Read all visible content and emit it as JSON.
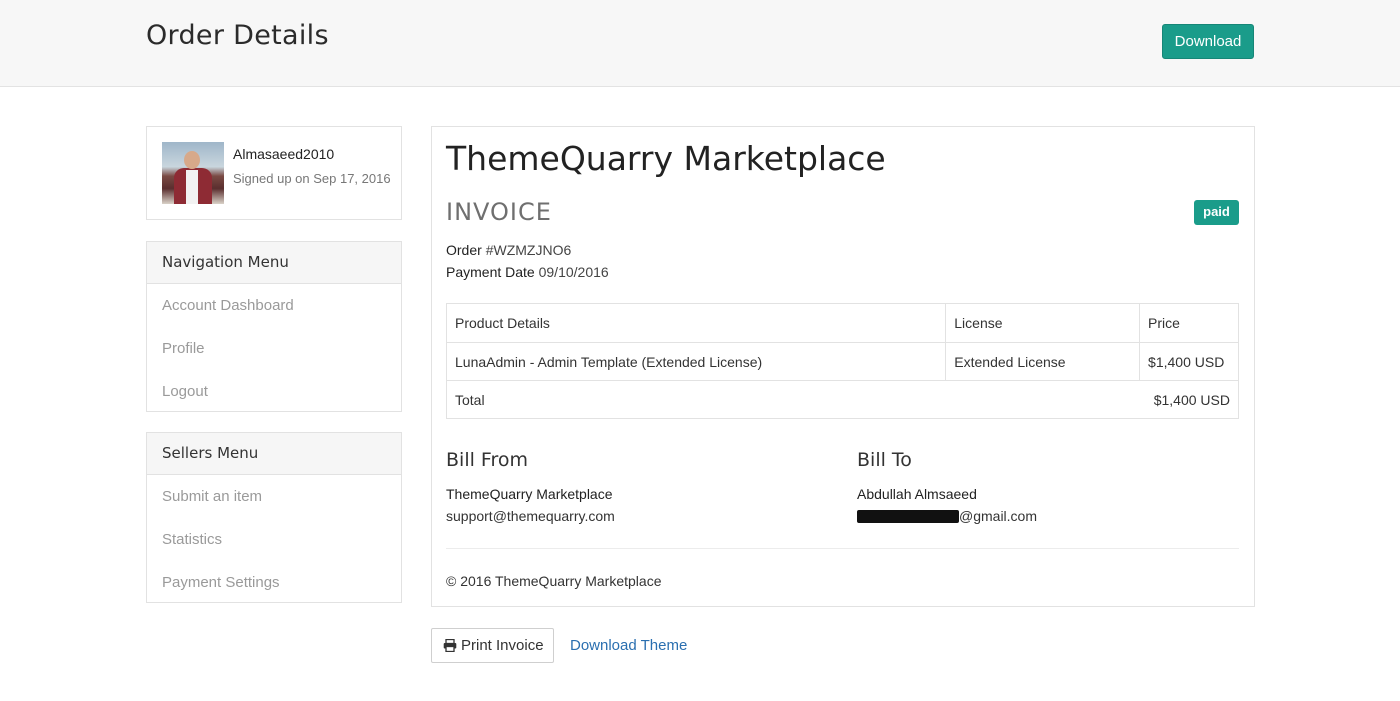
{
  "header": {
    "title": "Order Details",
    "download_label": "Download"
  },
  "profile": {
    "username": "Almasaeed2010",
    "signup": "Signed up on Sep 17, 2016"
  },
  "nav_menu": {
    "title": "Navigation Menu",
    "items": [
      {
        "label": "Account Dashboard"
      },
      {
        "label": "Profile"
      },
      {
        "label": "Logout"
      }
    ]
  },
  "sellers_menu": {
    "title": "Sellers Menu",
    "items": [
      {
        "label": "Submit an item"
      },
      {
        "label": "Statistics"
      },
      {
        "label": "Payment Settings"
      }
    ]
  },
  "invoice": {
    "company": "ThemeQuarry Marketplace",
    "label": "INVOICE",
    "status": "paid",
    "order_label": "Order",
    "order_number": "#WZMZJNO6",
    "payment_date_label": "Payment Date",
    "payment_date": "09/10/2016",
    "table": {
      "headers": [
        "Product Details",
        "License",
        "Price"
      ],
      "rows": [
        {
          "product": "LunaAdmin - Admin Template (Extended License)",
          "license": "Extended License",
          "price": "$1,400 USD"
        }
      ],
      "total_label": "Total",
      "total_value": "$1,400 USD"
    },
    "bill_from": {
      "title": "Bill From",
      "name": "ThemeQuarry Marketplace",
      "email": "support@themequarry.com"
    },
    "bill_to": {
      "title": "Bill To",
      "name": "Abdullah Almsaeed",
      "email_suffix": "@gmail.com"
    },
    "copyright": "© 2016 ThemeQuarry Marketplace"
  },
  "actions": {
    "print_label": "Print Invoice",
    "print_icon": "print-icon",
    "download_theme_label": "Download Theme"
  },
  "colors": {
    "accent": "#1a9c8a",
    "link": "#2a6fb0"
  }
}
